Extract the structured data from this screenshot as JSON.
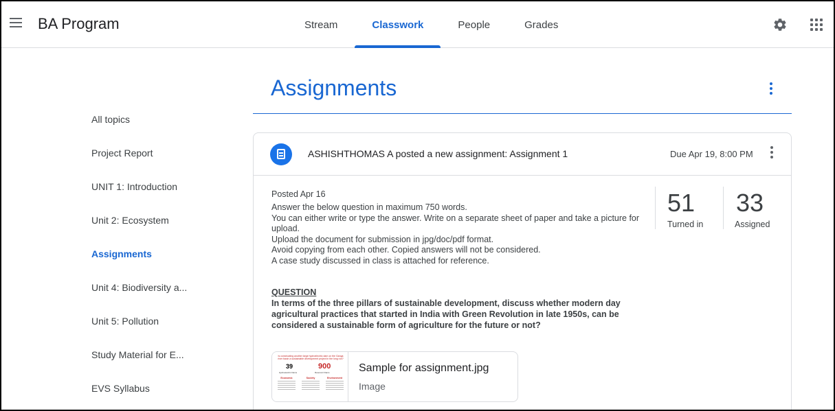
{
  "app": {
    "title": "BA Program"
  },
  "nav": {
    "tabs": [
      {
        "label": "Stream",
        "active": false
      },
      {
        "label": "Classwork",
        "active": true
      },
      {
        "label": "People",
        "active": false
      },
      {
        "label": "Grades",
        "active": false
      }
    ],
    "icons": {
      "menu": "hamburger-menu-icon",
      "settings": "gear-icon",
      "apps": "apps-grid-icon"
    }
  },
  "sidebar": {
    "items": [
      {
        "label": "All topics",
        "active": false
      },
      {
        "label": "Project Report",
        "active": false
      },
      {
        "label": "UNIT 1: Introduction",
        "active": false
      },
      {
        "label": "Unit 2: Ecosystem",
        "active": false
      },
      {
        "label": "Assignments",
        "active": true
      },
      {
        "label": "Unit 4: Biodiversity a...",
        "active": false
      },
      {
        "label": "Unit 5: Pollution",
        "active": false
      },
      {
        "label": "Study Material for E...",
        "active": false
      },
      {
        "label": "EVS Syllabus",
        "active": false
      }
    ]
  },
  "main": {
    "section_title": "Assignments",
    "assignment": {
      "header": "ASHISHTHOMAS A posted a new assignment: Assignment 1",
      "due": "Due Apr 19, 8:00 PM",
      "posted": "Posted Apr 16",
      "instructions": [
        "Answer the below question in maximum 750 words.",
        "You can either write or type the answer. Write on a separate sheet of paper and take a picture for upload.",
        "Upload the document for submission in jpg/doc/pdf format.",
        "Avoid copying from each other. Copied answers will not be considered.",
        "A case study discussed in class is attached for reference."
      ],
      "question_label": "QUESTION",
      "question": "In terms of the three pillars of sustainable development, discuss whether modern day agricultural practices that started in India with Green Revolution in late 1950s, can be considered a sustainable form of agriculture for the future or not?",
      "stats": {
        "turned_in": {
          "value": "51",
          "label": "Turned in"
        },
        "assigned": {
          "value": "33",
          "label": "Assigned"
        }
      },
      "attachment": {
        "name": "Sample for assignment.jpg",
        "type": "Image",
        "thumbnail": {
          "title": "Is constructing another large hydroelectric dam on the Ganga river basin a sustainable development project in the long run?",
          "num1": "39",
          "sub1": "Hydroelectric Dams",
          "num2": "900",
          "sub2": "Reservoir Dams",
          "columns": [
            "Economic",
            "Society",
            "Environment"
          ]
        }
      }
    }
  },
  "colors": {
    "accent": "#1967d2",
    "icon_blue": "#1a73e8",
    "text": "#3c4043",
    "divider": "#dadce0"
  }
}
